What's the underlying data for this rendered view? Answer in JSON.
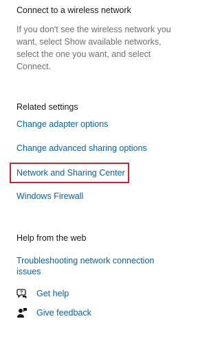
{
  "connect": {
    "heading": "Connect to a wireless network",
    "description": "If you don't see the wireless network you want, select Show available networks, select the one you want, and select Connect."
  },
  "related": {
    "heading": "Related settings",
    "links": [
      "Change adapter options",
      "Change advanced sharing options",
      "Network and Sharing Center",
      "Windows Firewall"
    ]
  },
  "help": {
    "heading": "Help from the web",
    "link": "Troubleshooting network connection issues"
  },
  "support": {
    "get_help": "Get help",
    "give_feedback": "Give feedback"
  },
  "colors": {
    "link": "#0063b1",
    "highlight": "#d2202f"
  },
  "icons": {
    "get_help": "chat-question-icon",
    "give_feedback": "feedback-person-icon"
  }
}
